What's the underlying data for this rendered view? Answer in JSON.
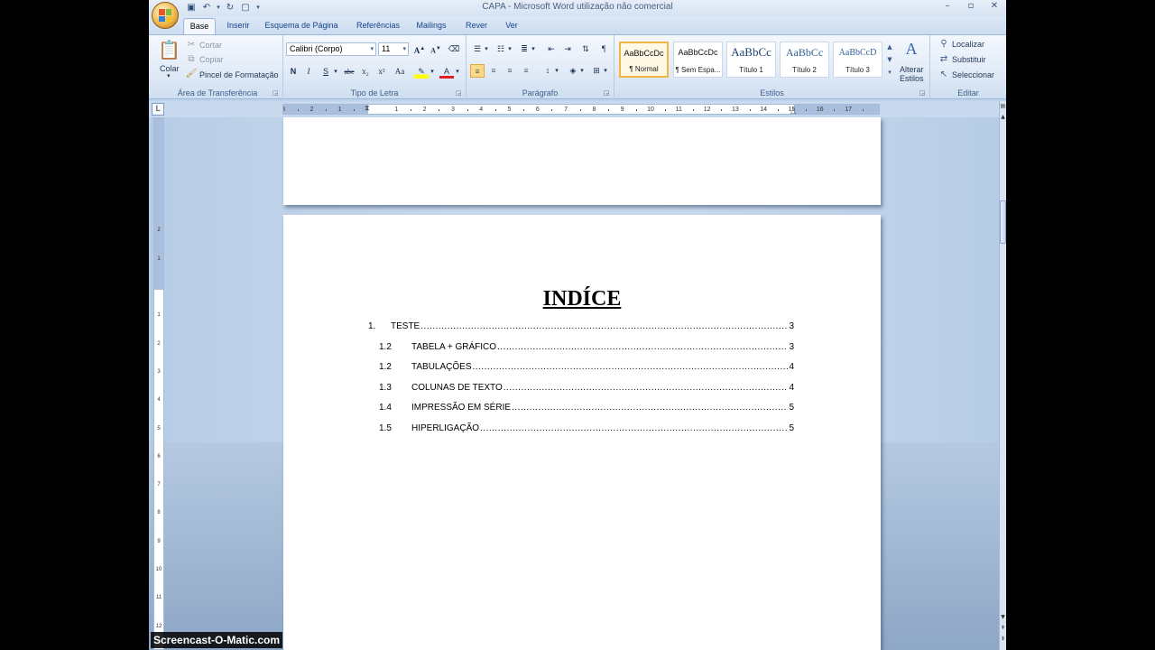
{
  "window": {
    "title": "CAPA - Microsoft Word utilização não comercial",
    "controls": [
      "–",
      "▫",
      "✕"
    ]
  },
  "tabs": [
    {
      "label": "Base",
      "active": true
    },
    {
      "label": "Inserir"
    },
    {
      "label": "Esquema de Página"
    },
    {
      "label": "Referências"
    },
    {
      "label": "Mailings"
    },
    {
      "label": "Rever"
    },
    {
      "label": "Ver"
    }
  ],
  "clipboard": {
    "paste": "Colar",
    "cut": "Cortar",
    "copy": "Copiar",
    "format_painter": "Pincel de Formatação",
    "group_label": "Área de Transferência"
  },
  "font": {
    "name": "Calibri (Corpo)",
    "size": "11",
    "bold": "N",
    "italic": "I",
    "underline": "S",
    "strike": "abc",
    "subscript": "x₂",
    "superscript": "x²",
    "change_case": "Aa",
    "grow": "A",
    "shrink": "A",
    "font_color": "A",
    "group_label": "Tipo de Letra"
  },
  "paragraph": {
    "group_label": "Parágrafo"
  },
  "styles": {
    "items": [
      {
        "preview": "AaBbCcDc",
        "name": "¶ Normal",
        "selected": true
      },
      {
        "preview": "AaBbCcDc",
        "name": "¶ Sem Espa..."
      },
      {
        "preview": "AaBbCc",
        "name": "Título 1"
      },
      {
        "preview": "AaBbCc",
        "name": "Título 2"
      },
      {
        "preview": "AaBbCcD",
        "name": "Título 3"
      }
    ],
    "change_styles": "Alterar",
    "change_styles_2": "Estilos",
    "group_label": "Estilos"
  },
  "editing": {
    "find": "Localizar",
    "replace": "Substituir",
    "select": "Seleccionar",
    "group_label": "Editar"
  },
  "ruler": {
    "tab_selector": "L",
    "labels": [
      "3",
      "2",
      "1",
      "1",
      "2",
      "3",
      "4",
      "5",
      "6",
      "7",
      "8",
      "9",
      "10",
      "11",
      "12",
      "13",
      "14",
      "15",
      "16",
      "17"
    ],
    "vlabels": [
      "2",
      "1",
      "1",
      "2",
      "3",
      "4",
      "5",
      "6",
      "7",
      "8",
      "9",
      "10",
      "11",
      "12"
    ]
  },
  "document": {
    "toc_title": "INDÍCE",
    "toc": [
      {
        "num": "1.",
        "label": "TESTE",
        "page": "3",
        "level": 1
      },
      {
        "num": "1.2",
        "label": "TABELA + GRÁFICO",
        "page": "3",
        "level": 2
      },
      {
        "num": "1.2",
        "label": "TABULAÇÕES",
        "page": "4",
        "level": 2
      },
      {
        "num": "1.3",
        "label": "COLUNAS DE TEXTO",
        "page": "4",
        "level": 2
      },
      {
        "num": "1.4",
        "label": "IMPRESSÃO EM SÉRIE",
        "page": "5",
        "level": 2
      },
      {
        "num": "1.5",
        "label": "HIPERLIGAÇÃO",
        "page": "5",
        "level": 2
      }
    ]
  },
  "watermark": "Screencast-O-Matic.com"
}
